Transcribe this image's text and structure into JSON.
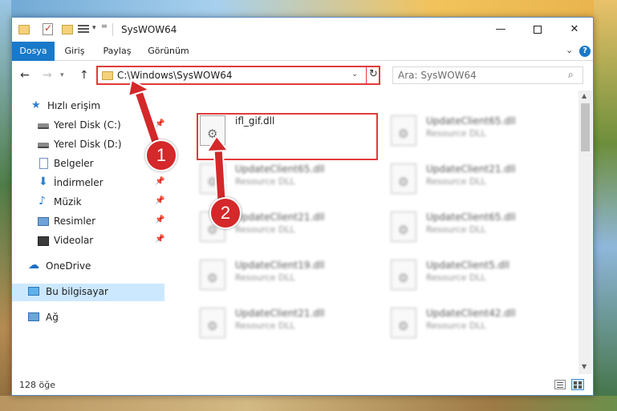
{
  "window": {
    "title": "SysWOW64",
    "min_glyph": "—",
    "max_glyph": "",
    "close_glyph": "✕"
  },
  "ribbon": {
    "tabs": [
      "Dosya",
      "Giriş",
      "Paylaş",
      "Görünüm"
    ],
    "help": "?",
    "collapse": "⌄"
  },
  "address": {
    "path": "C:\\Windows\\SysWOW64",
    "search_placeholder": "Ara: SysWOW64"
  },
  "sidebar": {
    "items": [
      {
        "label": "Hızlı erişim"
      },
      {
        "label": "Yerel Disk (C:)"
      },
      {
        "label": "Yerel Disk (D:)"
      },
      {
        "label": "Belgeler"
      },
      {
        "label": "İndirmeler"
      },
      {
        "label": "Müzik"
      },
      {
        "label": "Resimler"
      },
      {
        "label": "Videolar"
      },
      {
        "label": "OneDrive"
      },
      {
        "label": "Bu bilgisayar"
      },
      {
        "label": "Ağ"
      }
    ]
  },
  "files": [
    {
      "name": "ifl_gif.dll",
      "type": ""
    },
    {
      "name": "UpdateClient65.dll",
      "type": "Resource DLL"
    },
    {
      "name": "UpdateClient65.dll",
      "type": "Resource DLL"
    },
    {
      "name": "UpdateClient21.dll",
      "type": "Resource DLL"
    },
    {
      "name": "UpdateClient21.dll",
      "type": "Resource DLL"
    },
    {
      "name": "UpdateClient65.dll",
      "type": "Resource DLL"
    },
    {
      "name": "UpdateClient19.dll",
      "type": "Resource DLL"
    },
    {
      "name": "UpdateClient5.dll",
      "type": "Resource DLL"
    },
    {
      "name": "UpdateClient21.dll",
      "type": "Resource DLL"
    },
    {
      "name": "UpdateClient42.dll",
      "type": "Resource DLL"
    }
  ],
  "status": {
    "count": "128 öğe"
  },
  "annotations": {
    "step1": "1",
    "step2": "2",
    "color": "#d4282a"
  }
}
